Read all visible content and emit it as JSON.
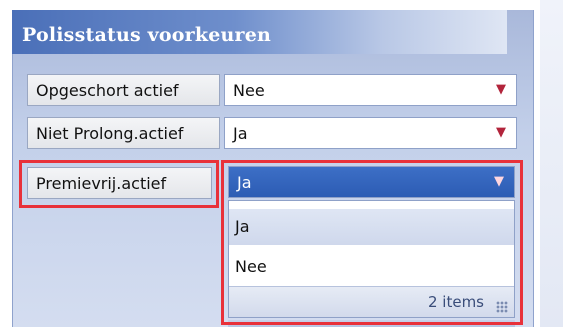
{
  "panel": {
    "title": "Polisstatus voorkeuren"
  },
  "rows": [
    {
      "label": "Opgeschort actief",
      "value": "Nee",
      "state": "closed"
    },
    {
      "label": "Niet Prolong.actief",
      "value": "Ja",
      "state": "closed"
    },
    {
      "label": "Premievrij.actief",
      "value": "Ja",
      "state": "open"
    }
  ],
  "dropdown": {
    "options": [
      "Ja",
      "Nee"
    ],
    "hovered": "Ja",
    "count_text": "2 items"
  },
  "colors": {
    "highlight": "#e8313a",
    "selected_bg": "#3d6fc6",
    "arrow": "#b2243b"
  },
  "icons": {
    "dropdown_arrow": "chevron-down-icon",
    "resize_grip": "resize-grip-icon"
  }
}
